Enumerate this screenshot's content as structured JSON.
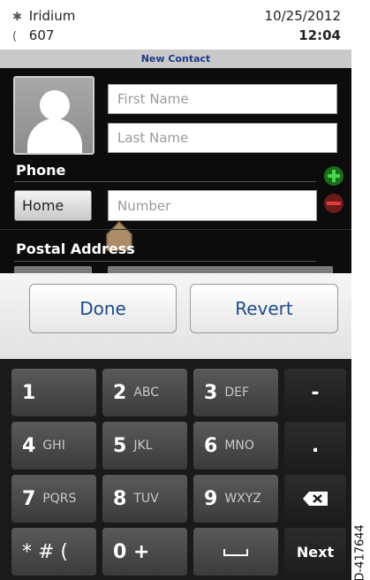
{
  "status_bar": {
    "network": "Iridium",
    "signal_value": "607",
    "date": "10/25/2012",
    "time": "12:04",
    "network_icon": "satellite-icon",
    "signal_icon": "phone-handset-icon"
  },
  "title_bar": {
    "title": "New Contact"
  },
  "contact_form": {
    "first_name_placeholder": "First Name",
    "last_name_placeholder": "Last Name",
    "phone_section": "Phone",
    "phone_type": "Home",
    "number_placeholder": "Number",
    "postal_section": "Postal Address"
  },
  "actions": {
    "done": "Done",
    "revert": "Revert"
  },
  "keypad": {
    "rows": [
      [
        {
          "main": "1",
          "sub": ""
        },
        {
          "main": "2",
          "sub": "ABC"
        },
        {
          "main": "3",
          "sub": "DEF"
        },
        {
          "main": "-",
          "sub": ""
        }
      ],
      [
        {
          "main": "4",
          "sub": "GHI"
        },
        {
          "main": "5",
          "sub": "JKL"
        },
        {
          "main": "6",
          "sub": "MNO"
        },
        {
          "main": ".",
          "sub": ""
        }
      ],
      [
        {
          "main": "7",
          "sub": "PQRS"
        },
        {
          "main": "8",
          "sub": "TUV"
        },
        {
          "main": "9",
          "sub": "WXYZ"
        },
        {
          "main": "",
          "sub": ""
        }
      ],
      [
        {
          "main": "* # (",
          "sub": ""
        },
        {
          "main": "0 +",
          "sub": ""
        },
        {
          "main": "",
          "sub": ""
        },
        {
          "main": "Next",
          "sub": ""
        }
      ]
    ]
  },
  "doc_id": "D-417644",
  "colors": {
    "accent_blue": "#1e4a8c",
    "plus_green": "#2ca02c",
    "minus_red": "#d22020"
  }
}
